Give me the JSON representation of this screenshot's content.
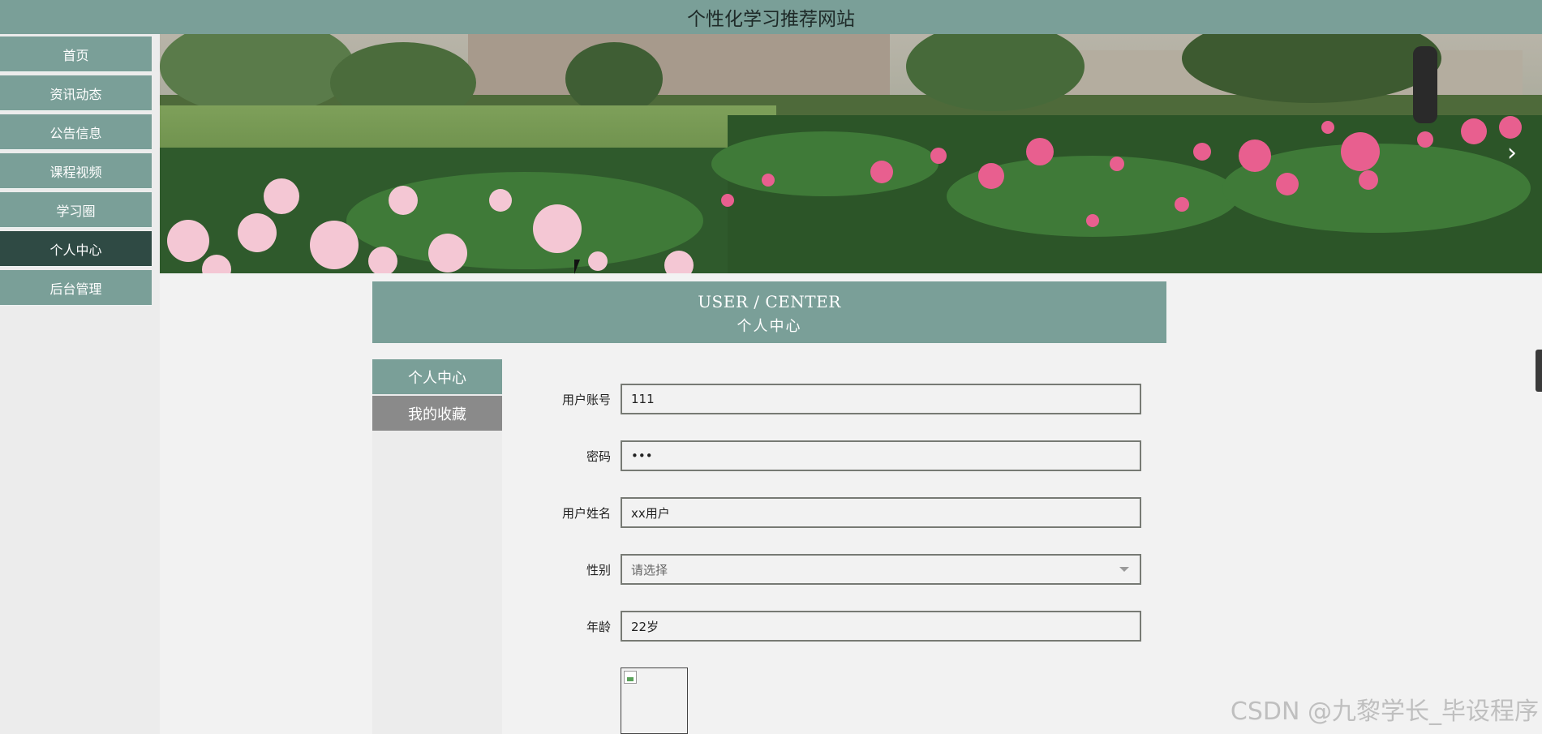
{
  "site": {
    "title": "个性化学习推荐网站"
  },
  "nav": {
    "items": [
      {
        "label": "首页"
      },
      {
        "label": "资讯动态"
      },
      {
        "label": "公告信息"
      },
      {
        "label": "课程视频"
      },
      {
        "label": "学习圈"
      },
      {
        "label": "个人中心",
        "active": true
      },
      {
        "label": "后台管理"
      }
    ]
  },
  "banner": {
    "next_icon": "chevron-right-icon"
  },
  "panel": {
    "title_en": "USER / CENTER",
    "title_cn": "个人中心"
  },
  "tabs": [
    {
      "label": "个人中心",
      "active": true
    },
    {
      "label": "我的收藏"
    }
  ],
  "form": {
    "account_label": "用户账号",
    "account_value": "111",
    "password_label": "密码",
    "password_value": "•••",
    "name_label": "用户姓名",
    "name_value": "xx用户",
    "gender_label": "性别",
    "gender_placeholder": "请选择",
    "age_label": "年龄",
    "age_value": "22岁"
  },
  "watermark": "CSDN @九黎学长_毕设程序",
  "colors": {
    "accent": "#7a9f98",
    "active_nav": "#2f4a44",
    "tab_inactive": "#8a8a8a"
  }
}
